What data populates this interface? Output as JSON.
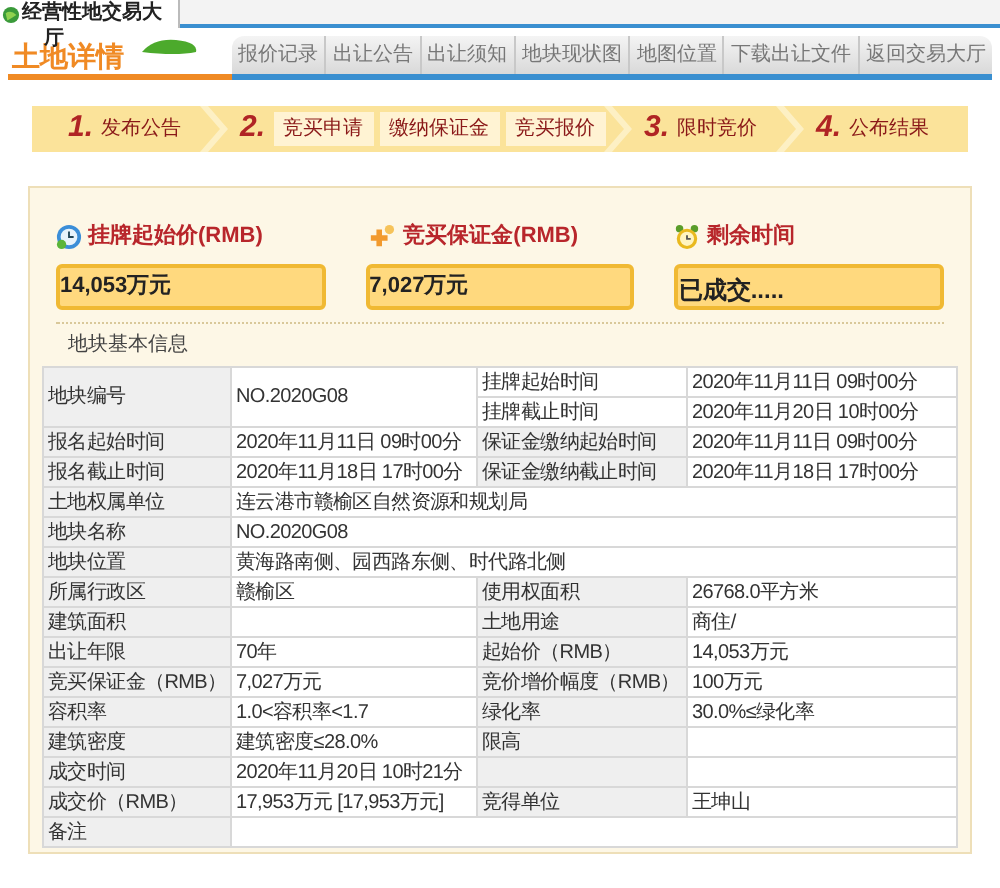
{
  "window": {
    "title": "经营性地交易大",
    "title_wrap": "厅"
  },
  "header": {
    "logo_text": "土地详情",
    "tabs": [
      "报价记录",
      "出让公告",
      "出让须知",
      "地块现状图",
      "地图位置",
      "下载出让文件",
      "返回交易大厅"
    ]
  },
  "steps": [
    {
      "number": "1.",
      "label": "发布公告"
    },
    {
      "number": "2.",
      "substeps": [
        "竞买申请",
        "缴纳保证金",
        "竞买报价"
      ]
    },
    {
      "number": "3.",
      "label": "限时竞价"
    },
    {
      "number": "4.",
      "label": "公布结果"
    }
  ],
  "cards": [
    {
      "kind": "price",
      "title": "挂牌起始价(RMB)",
      "value": "14,053万元"
    },
    {
      "kind": "deposit",
      "title": "竞买保证金(RMB)",
      "value": "7,027万元"
    },
    {
      "kind": "time",
      "title": "剩余时间",
      "value": "已成交....."
    }
  ],
  "section_title": "地块基本信息",
  "table": {
    "rows": [
      {
        "kind": "split",
        "label": "地块编号",
        "value": "NO.2020G08",
        "sub_rows": [
          {
            "label": "挂牌起始时间",
            "value": "2020年11月11日 09时00分"
          },
          {
            "label": "挂牌截止时间",
            "value": "2020年11月20日 10时00分"
          }
        ]
      },
      {
        "kind": "pair",
        "label": "报名起始时间",
        "value": "2020年11月11日 09时00分",
        "label_2": "保证金缴纳起始时间",
        "value_2": "2020年11月11日 09时00分"
      },
      {
        "kind": "pair",
        "label": "报名截止时间",
        "value": "2020年11月18日 17时00分",
        "label_2": "保证金缴纳截止时间",
        "value_2": "2020年11月18日 17时00分"
      },
      {
        "kind": "wide",
        "label": "土地权属单位",
        "value": "连云港市赣榆区自然资源和规划局"
      },
      {
        "kind": "wide",
        "label": "地块名称",
        "value": "NO.2020G08"
      },
      {
        "kind": "wide",
        "label": "地块位置",
        "value": "黄海路南侧、园西路东侧、时代路北侧"
      },
      {
        "kind": "pair",
        "label": "所属行政区",
        "value": "赣榆区",
        "label_2": "使用权面积",
        "value_2": "26768.0平方米"
      },
      {
        "kind": "pair",
        "label": "建筑面积",
        "label_2": "土地用途",
        "value_2": "商住/"
      },
      {
        "kind": "pair",
        "label": "出让年限",
        "value": "70年",
        "label_2": "起始价（RMB）",
        "value_2": "14,053万元"
      },
      {
        "kind": "pair",
        "label": "竞买保证金（RMB）",
        "value": "7,027万元",
        "label_2": "竞价增价幅度（RMB）",
        "value_2": "100万元"
      },
      {
        "kind": "pair",
        "label": "容积率",
        "value": "1.0<容积率<1.7",
        "label_2": "绿化率",
        "value_2": "30.0%≤绿化率"
      },
      {
        "kind": "pair",
        "label": "建筑密度",
        "value": "建筑密度≤28.0%",
        "label_2": "限高"
      },
      {
        "kind": "pair",
        "label": "成交时间",
        "value": "2020年11月20日 10时21分"
      },
      {
        "kind": "pair",
        "label": "成交价（RMB）",
        "value": "17,953万元 [17,953万元]",
        "label_2": "竞得单位",
        "value_2": "王坤山"
      },
      {
        "kind": "wide",
        "label": "备注"
      }
    ]
  }
}
